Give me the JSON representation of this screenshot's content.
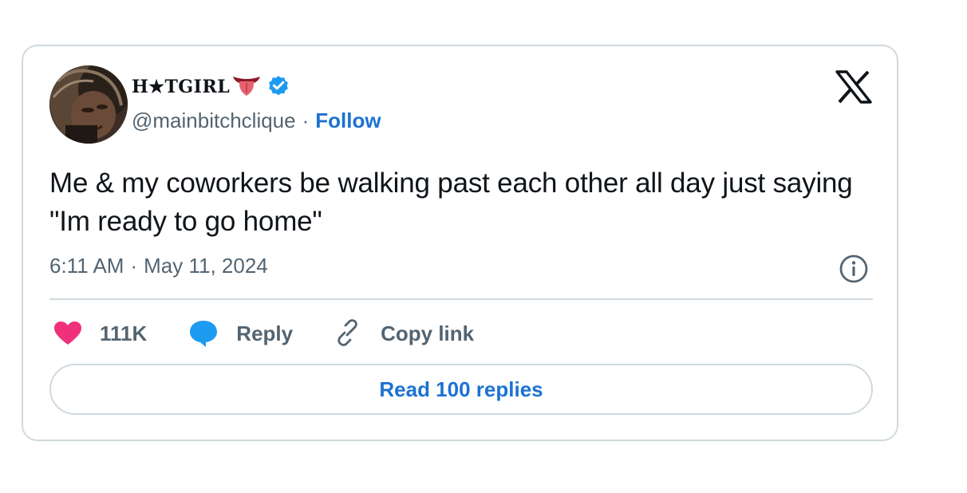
{
  "author": {
    "display_name": "H★TGIRL",
    "handle": "@mainbitchclique",
    "separator": "·",
    "follow_label": "Follow"
  },
  "tweet": {
    "text": "Me & my coworkers be walking past each other all day just saying \"Im ready to go home\"",
    "time": "6:11 AM",
    "date_separator": "·",
    "date": "May 11, 2024"
  },
  "actions": {
    "likes": "111K",
    "reply_label": "Reply",
    "copy_link_label": "Copy link"
  },
  "read_replies_label": "Read 100 replies",
  "icons": {
    "tongue": "tongue-emoji-icon",
    "verified": "verified-badge-icon",
    "logo": "x-logo-icon",
    "info": "info-icon",
    "like": "heart-icon",
    "reply": "speech-bubble-icon",
    "copy": "link-icon"
  },
  "colors": {
    "accent": "#1d72d1",
    "like": "#f0307a",
    "reply": "#1d9bf0",
    "muted": "#536471",
    "border": "#cfd9de"
  }
}
